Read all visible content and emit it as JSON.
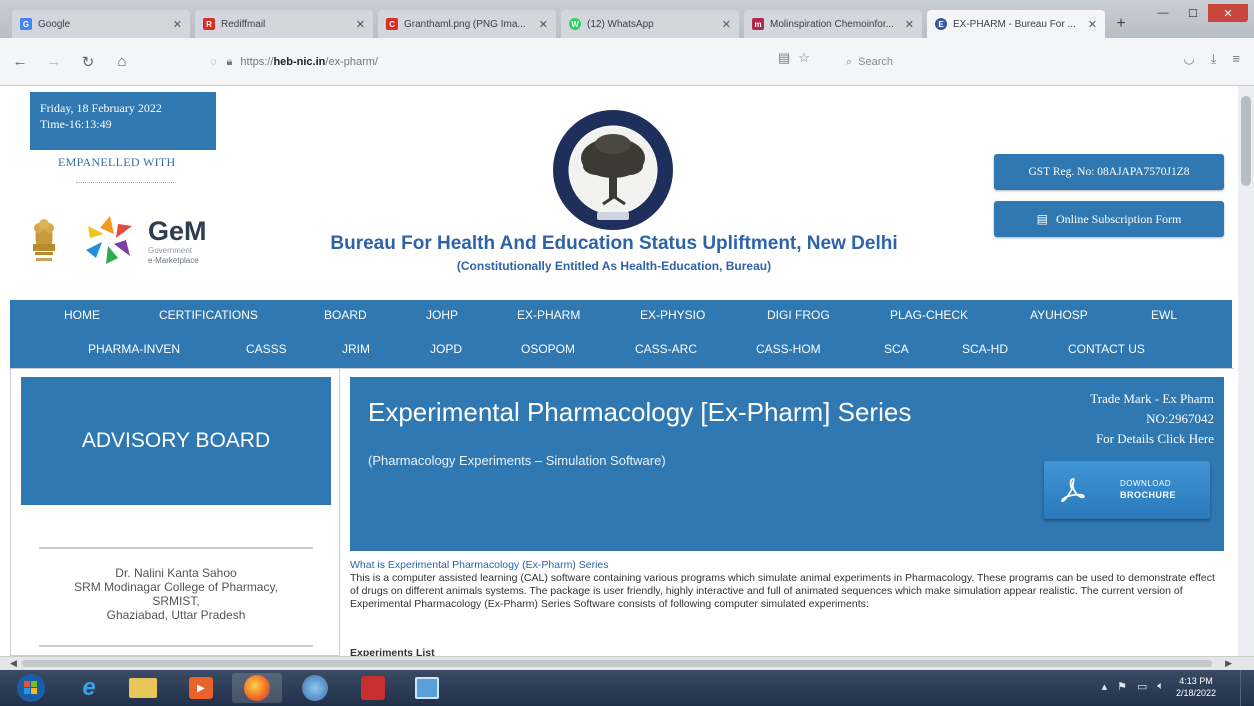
{
  "browser": {
    "tabs": [
      {
        "title": "Google",
        "color": "#4285f4",
        "glyph": "G",
        "active": false
      },
      {
        "title": "Rediffmail",
        "color": "#d93025",
        "glyph": "R",
        "active": false
      },
      {
        "title": "Granthaml.png (PNG Ima...",
        "color": "#d93025",
        "glyph": "C",
        "active": false
      },
      {
        "title": "(12) WhatsApp",
        "color": "#25d366",
        "glyph": "W",
        "active": false
      },
      {
        "title": "Molinspiration Chemoinfor...",
        "color": "#b0264e",
        "glyph": "m",
        "active": false
      },
      {
        "title": "EX-PHARM - Bureau For ...",
        "color": "#3b5998",
        "glyph": "E",
        "active": true
      }
    ],
    "url_prefix": "https://",
    "url_domain": "heb-nic.in",
    "url_path": "/ex-pharm/",
    "search_placeholder": "Search"
  },
  "header": {
    "date": "Friday, 18 February 2022",
    "time": "Time-16:13:49",
    "empanelled": "EMPANELLED WITH",
    "gem_word": "GeM",
    "gem_sub1": "Government",
    "gem_sub2": "e-Marketplace",
    "org_title": "Bureau For Health And Education Status Upliftment, New Delhi",
    "org_subtitle": "(Constitutionally Entitled As Health-Education, Bureau)",
    "gst": "GST Reg. No: 08AJAPA7570J1Z8",
    "subscription": "Online Subscription Form"
  },
  "menu": {
    "row1": [
      "HOME",
      "CERTIFICATIONS",
      "BOARD",
      "JOHP",
      "EX-PHARM",
      "EX-PHYSIO",
      "DIGI FROG",
      "PLAG-CHECK",
      "AYUHOSP",
      "EWL"
    ],
    "row2": [
      "PHARMA-INVEN",
      "CASSS",
      "JRIM",
      "JOPD",
      "OSOPOM",
      "CASS-ARC",
      "CASS-HOM",
      "SCA",
      "SCA-HD",
      "CONTACT US"
    ]
  },
  "sidebar": {
    "title": "ADVISORY BOARD",
    "person_name": "Dr. Nalini Kanta Sahoo",
    "person_line2": "SRM Modinagar College of Pharmacy,",
    "person_line3": "SRMIST,",
    "person_line4": "Ghaziabad, Uttar Pradesh"
  },
  "main": {
    "title": "Experimental Pharmacology [Ex-Pharm] Series",
    "subtitle": "(Pharmacology Experiments – Simulation Software)",
    "trademark1": "Trade Mark - Ex Pharm",
    "trademark2": "NO:2967042",
    "trademark3": "For Details Click Here",
    "download_line1": "DOWNLOAD",
    "download_line2": "BROCHURE",
    "question": "What is Experimental Pharmacology  (Ex-Pharm) Series",
    "paragraph": "This is a computer assisted learning (CAL) software containing various programs which simulate animal experiments in Pharmacology. These programs can be used to demonstrate effect of drugs on different animals systems. The package is user friendly, highly interactive and full of animated sequences which make simulation appear realistic. The current version of Experimental Pharmacology  (Ex-Pharm) Series Software consists of following computer simulated experiments:",
    "list_heading": "Experiments List"
  },
  "taskbar": {
    "time": "4:13 PM",
    "date": "2/18/2022"
  },
  "colors": {
    "primary": "#2f78b2",
    "title_blue": "#2f63a9"
  }
}
